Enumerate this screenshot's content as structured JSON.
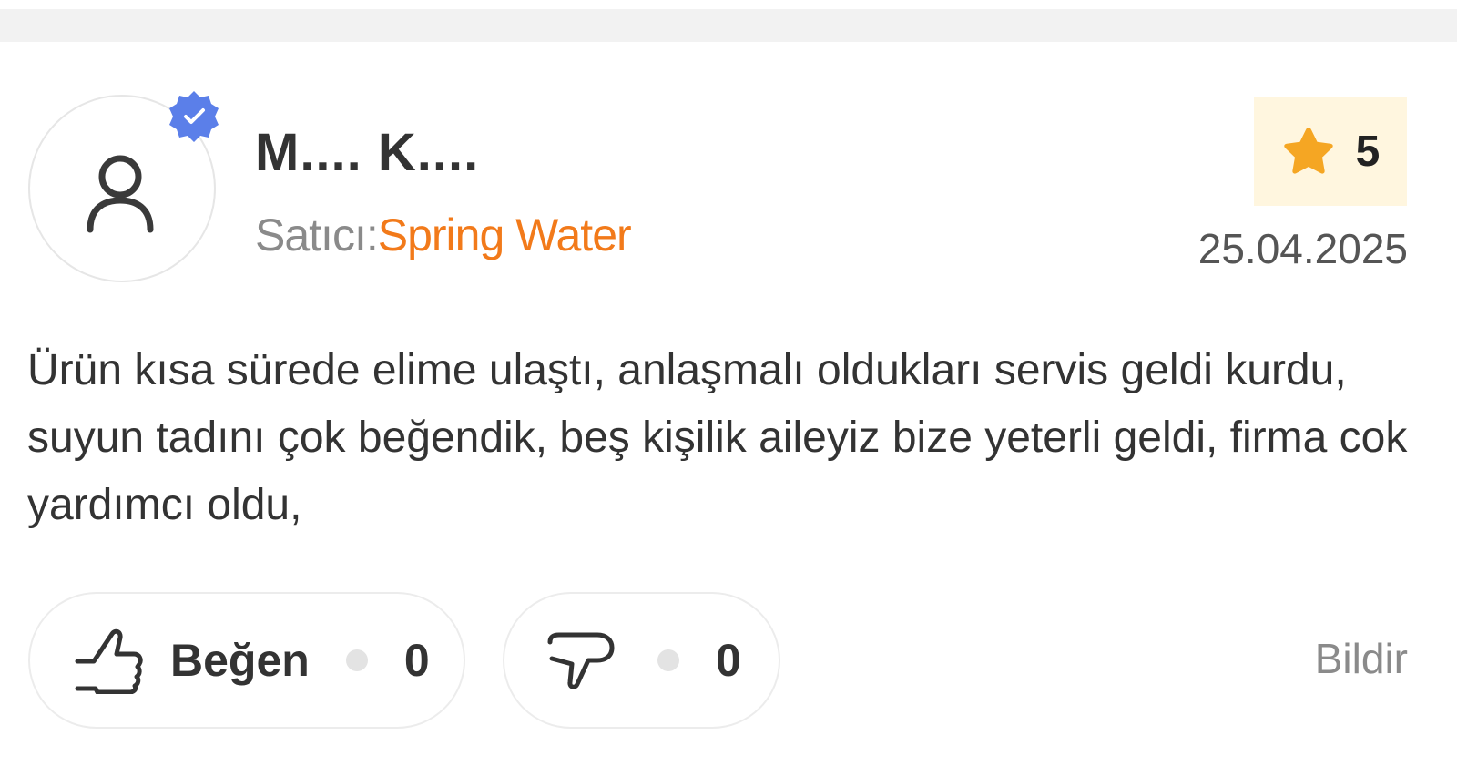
{
  "review": {
    "reviewer_name": "M.... K....",
    "seller_label": "Satıcı:",
    "seller_name": "Spring Water",
    "rating": "5",
    "date": "25.04.2025",
    "text": "Ürün kısa sürede elime ulaştı, anlaşmalı oldukları servis geldi kurdu, suyun tadını çok beğendik, beş kişilik aileyiz bize yeterli geldi, firma cok yardımcı oldu,"
  },
  "actions": {
    "like_label": "Beğen",
    "like_count": "0",
    "dislike_count": "0",
    "report_label": "Bildir"
  },
  "colors": {
    "accent": "#f27a1a",
    "star": "#f5a623",
    "verified_badge": "#5b7fe9",
    "rating_bg": "#fff6df"
  },
  "icons": {
    "avatar": "user-icon",
    "verified": "verified-badge-icon",
    "rating": "star-icon",
    "like": "thumbs-up-icon",
    "dislike": "thumbs-down-icon"
  }
}
